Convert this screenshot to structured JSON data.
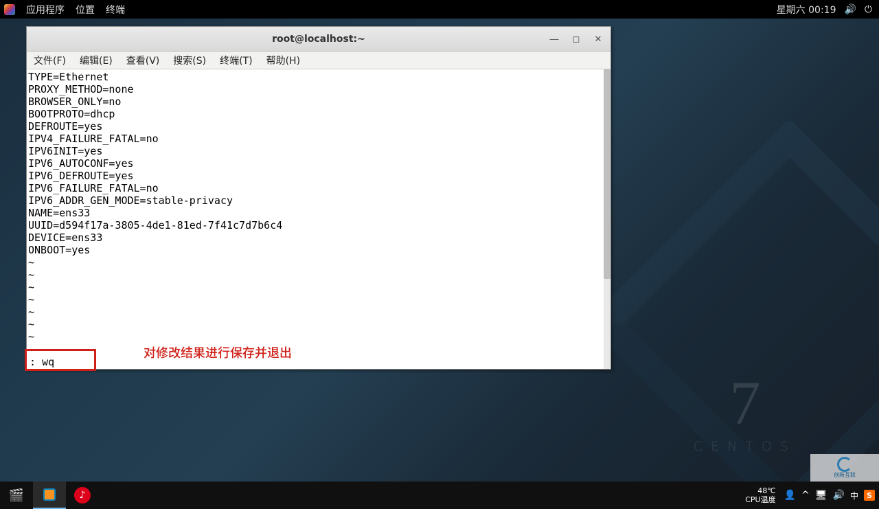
{
  "top_panel": {
    "apps": "应用程序",
    "places": "位置",
    "terminal": "终端",
    "clock": "星期六 00:19"
  },
  "window": {
    "title": "root@localhost:~",
    "menu": {
      "file": "文件(F)",
      "edit": "编辑(E)",
      "view": "查看(V)",
      "search": "搜索(S)",
      "terminal": "终端(T)",
      "help": "帮助(H)"
    }
  },
  "file_lines": [
    "TYPE=Ethernet",
    "PROXY_METHOD=none",
    "BROWSER_ONLY=no",
    "BOOTPROTO=dhcp",
    "DEFROUTE=yes",
    "IPV4_FAILURE_FATAL=no",
    "IPV6INIT=yes",
    "IPV6_AUTOCONF=yes",
    "IPV6_DEFROUTE=yes",
    "IPV6_FAILURE_FATAL=no",
    "IPV6_ADDR_GEN_MODE=stable-privacy",
    "NAME=ens33",
    "UUID=d594f17a-3805-4de1-81ed-7f41c7d7b6c4",
    "DEVICE=ens33",
    "ONBOOT=yes"
  ],
  "tilde_count": 7,
  "vi_command": ": wq",
  "annotation": "对修改结果进行保存并退出",
  "centos": {
    "version": "7",
    "name": "CENTOS"
  },
  "taskbar": {
    "temp": "48℃",
    "temp_label": "CPU温度",
    "ime": "中"
  },
  "watermark": "创新互联"
}
